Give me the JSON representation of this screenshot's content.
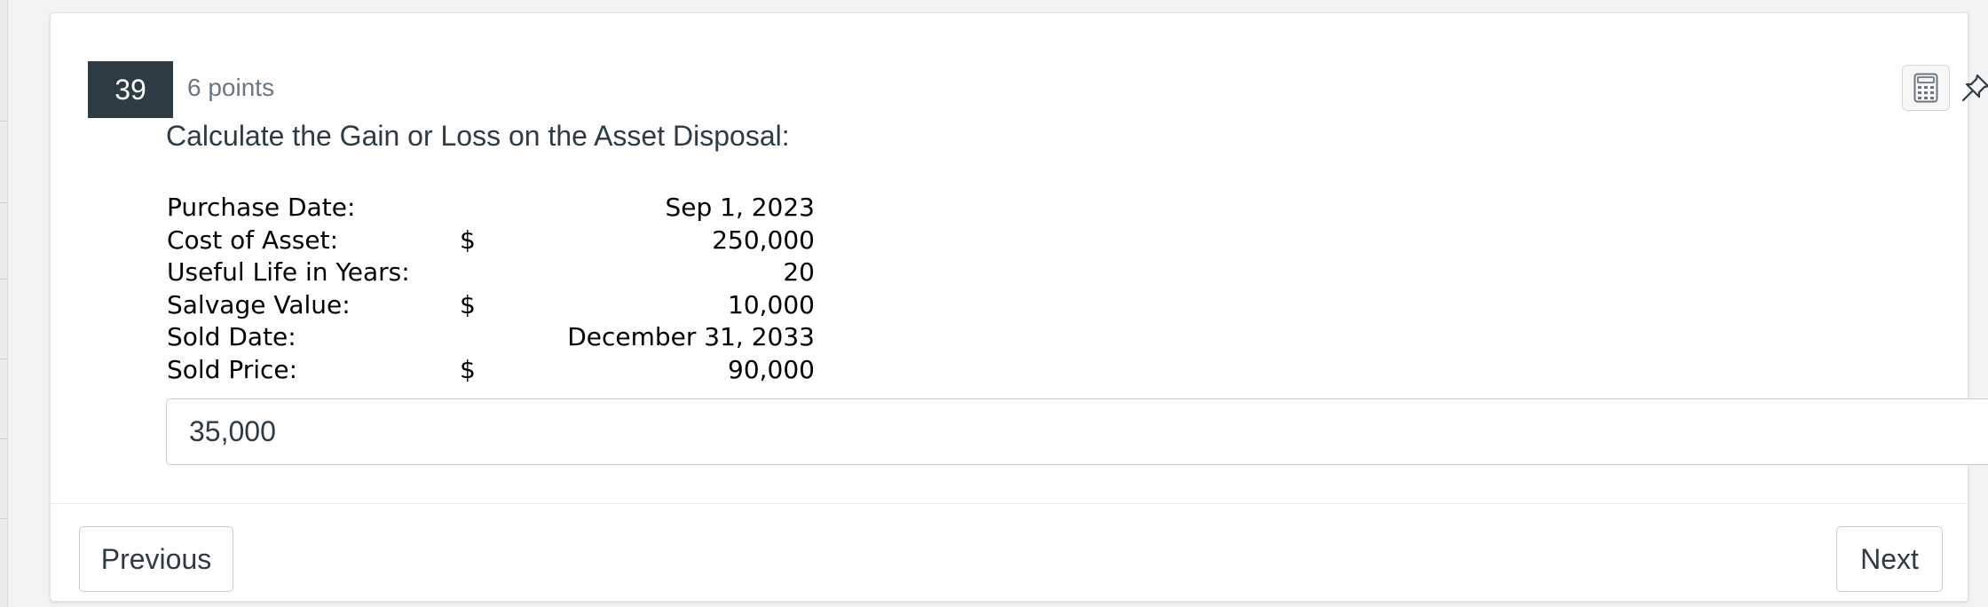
{
  "question": {
    "number": "39",
    "points": "6 points",
    "title": "Calculate the Gain or Loss on the Asset Disposal:"
  },
  "toolbar": {
    "calculator_icon": "calculator-icon",
    "pin_icon": "pin-icon"
  },
  "details": [
    {
      "label": "Purchase Date:",
      "symbol": "",
      "value": "Sep 1, 2023"
    },
    {
      "label": "Cost of Asset:",
      "symbol": "$",
      "value": "250,000"
    },
    {
      "label": "Useful Life in Years:",
      "symbol": "",
      "value": "20"
    },
    {
      "label": "Salvage Value:",
      "symbol": "$",
      "value": "10,000"
    },
    {
      "label": "Sold Date:",
      "symbol": "",
      "value": "December 31, 2033"
    },
    {
      "label": "Sold Price:",
      "symbol": "$",
      "value": "90,000"
    }
  ],
  "answer": {
    "value": "35,000"
  },
  "nav": {
    "previous_label": "Previous",
    "next_label": "Next"
  },
  "colors": {
    "badge_bg": "#2d3b45",
    "text": "#2d3b45",
    "muted": "#6b7780"
  }
}
